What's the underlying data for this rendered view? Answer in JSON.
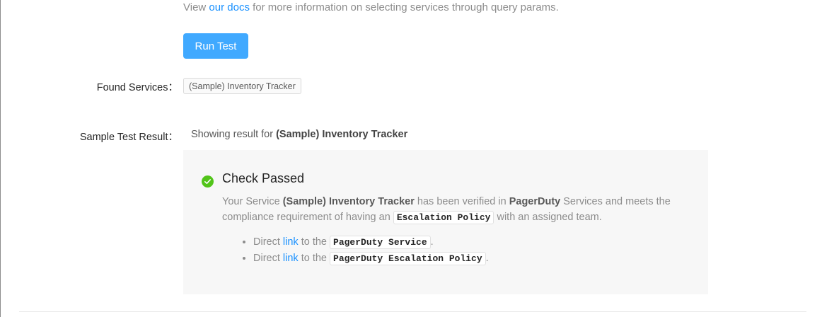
{
  "hint": {
    "prefix": "View ",
    "link": "our docs",
    "suffix": " for more information on selecting services through query params."
  },
  "run_test_button": "Run Test",
  "found_services": {
    "label": "Found Services：",
    "tags": [
      "(Sample) Inventory Tracker"
    ]
  },
  "sample_result": {
    "label": "Sample Test Result：",
    "prefix": "Showing result for ",
    "service": "(Sample) Inventory Tracker"
  },
  "check": {
    "icon": "check-circle-icon",
    "status_color": "#52c41a",
    "title": "Check Passed",
    "desc_1": "Your Service ",
    "desc_service": "(Sample) Inventory Tracker",
    "desc_2": " has been verified in ",
    "desc_provider": "PagerDuty",
    "desc_3": " Services and meets the compliance requirement of having an ",
    "desc_code": "Escalation Policy",
    "desc_4": " with an assigned team.",
    "links": [
      {
        "prefix": "Direct ",
        "link": "link",
        "middle": " to the ",
        "code": "PagerDuty Service",
        "suffix": "."
      },
      {
        "prefix": "Direct ",
        "link": "link",
        "middle": " to the ",
        "code": "PagerDuty Escalation Policy",
        "suffix": "."
      }
    ]
  },
  "colors": {
    "primary": "#40a9ff",
    "link": "#1890ff",
    "panel_bg": "#f7f7f7"
  }
}
